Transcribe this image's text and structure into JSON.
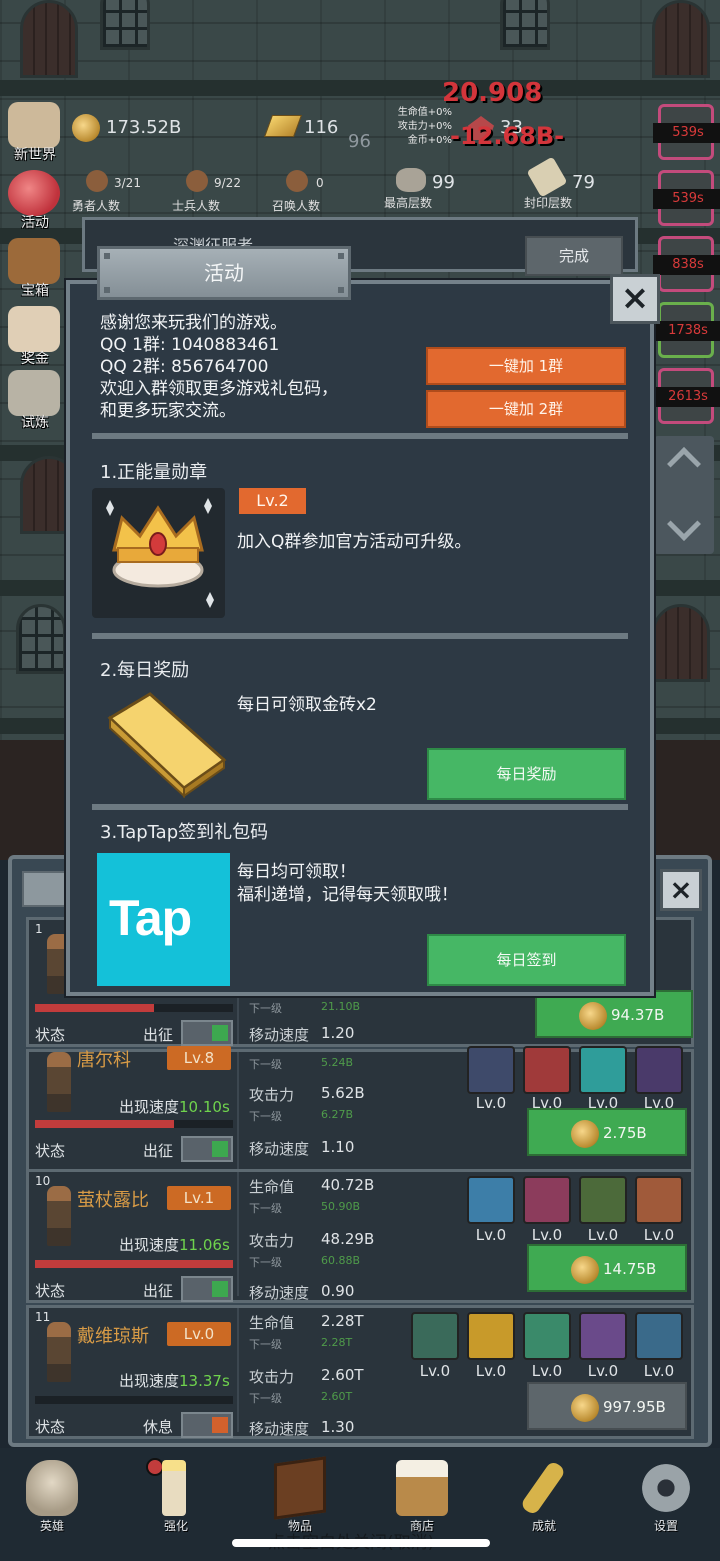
{
  "hud": {
    "gold": "173.52B",
    "bricks": "116",
    "bricks_sub": "96",
    "gems": "33",
    "boss_damage": "20.908",
    "damage_popup": "-12.68B-",
    "bonus_hp": "生命值+0%",
    "bonus_atk": "攻击力+0%",
    "bonus_gold": "金币+0%",
    "heroes_count": "3/21",
    "heroes_label": "勇者人数",
    "soldiers_count": "9/22",
    "soldiers_label": "士兵人数",
    "summon_count": "0",
    "summon_label": "召唤人数",
    "top_floor": "99",
    "top_floor_label": "最高层数",
    "sealed_floor": "79",
    "sealed_floor_label": "封印层数"
  },
  "left_nav": [
    "新世界",
    "活动",
    "宝箱",
    "奖金",
    "试炼"
  ],
  "right_timers": [
    "539s",
    "539s",
    "838s",
    "1738s",
    "2613s"
  ],
  "quest_banner": {
    "title": "深渊征服者",
    "button": "完成"
  },
  "modal": {
    "title": "活动",
    "close_icon": "×",
    "intro": {
      "line1": "感谢您来玩我们的游戏。",
      "line2": "QQ 1群: 1040883461",
      "line3": "QQ 2群: 856764700",
      "line4": "欢迎入群领取更多游戏礼包码，",
      "line5": "和更多玩家交流。"
    },
    "join1": "一键加 1群",
    "join2": "一键加 2群",
    "section1": {
      "title": "1.正能量勋章",
      "level": "Lv.2",
      "desc": "加入Q群参加官方活动可升级。"
    },
    "section2": {
      "title": "2.每日奖励",
      "desc": "每日可领取金砖x2",
      "button": "每日奖励"
    },
    "section3": {
      "title": "3.TapTap签到礼包码",
      "logo_text": "Tap",
      "desc1": "每日均可领取！",
      "desc2": "福利递增，记得每天领取哦！",
      "button": "每日签到"
    }
  },
  "hero_list": {
    "labels": {
      "status": "状态",
      "appear_speed": "出现速度",
      "move_speed": "移动速度",
      "hp": "生命值",
      "atk": "攻击力",
      "next": "下一级",
      "skill_lv": "Lv.0"
    },
    "heroes": [
      {
        "num": "1",
        "name": "",
        "level": "",
        "appear": "",
        "state": "出征",
        "state_color": "#3da84f",
        "hp": "",
        "hp_next": "21.10B",
        "atk": "",
        "atk_next": "",
        "move": "1.20",
        "cost": "94.37B",
        "hp_fill": 0.6
      },
      {
        "num": "",
        "name": "唐尔科",
        "level": "Lv.8",
        "appear": "10.10s",
        "state": "出征",
        "state_color": "#3da84f",
        "hp": "",
        "hp_next": "5.24B",
        "atk": "5.62B",
        "atk_next": "6.27B",
        "move": "1.10",
        "cost": "2.75B",
        "hp_fill": 0.7
      },
      {
        "num": "10",
        "name": "萤杖露比",
        "level": "Lv.1",
        "appear": "11.06s",
        "state": "出征",
        "state_color": "#3da84f",
        "hp": "40.72B",
        "hp_next": "50.90B",
        "atk": "48.29B",
        "atk_next": "60.88B",
        "move": "0.90",
        "cost": "14.75B",
        "hp_fill": 1.0
      },
      {
        "num": "11",
        "name": "戴维琼斯",
        "level": "Lv.0",
        "appear": "13.37s",
        "state": "休息",
        "state_color": "#d2612c",
        "hp": "2.28T",
        "hp_next": "2.28T",
        "atk": "2.60T",
        "atk_next": "2.60T",
        "move": "1.30",
        "cost": "997.95B",
        "hp_fill": 0.0
      }
    ]
  },
  "bottom_nav": [
    "英雄",
    "强化",
    "物品",
    "商店",
    "成就",
    "设置"
  ],
  "close_hint": "点击空白处关闭(取消)"
}
